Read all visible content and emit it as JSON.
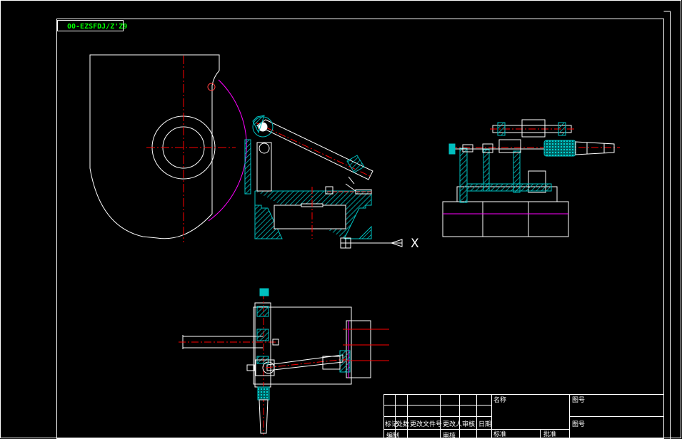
{
  "drawing_tag": "00-EZSFDJ/Z'Z9",
  "axis_label": "X",
  "colors": {
    "background": "#000000",
    "frame": "#ffffff",
    "centerline": "#ff0000",
    "arc": "#ff00ff",
    "hatch": "#00bfbf",
    "tag": "#00ff00"
  },
  "title_block": {
    "header_cells": [
      "标记",
      "处数",
      "更改文件号",
      "更改人",
      "审核",
      "日期"
    ],
    "bottom_cells": [
      "编制",
      "审核",
      "标准",
      "批准"
    ],
    "top_right": [
      "名称",
      "图号"
    ]
  }
}
